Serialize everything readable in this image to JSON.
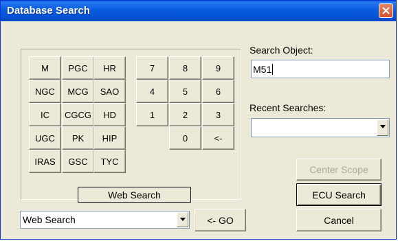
{
  "window": {
    "title": "Database Search",
    "close_icon": "close-icon"
  },
  "keypad": {
    "catalog_buttons": [
      [
        "M",
        "PGC",
        "HR"
      ],
      [
        "NGC",
        "MCG",
        "SAO"
      ],
      [
        "IC",
        "CGCG",
        "HD"
      ],
      [
        "UGC",
        "PK",
        "HIP"
      ],
      [
        "IRAS",
        "GSC",
        "TYC"
      ]
    ],
    "number_buttons": [
      [
        "7",
        "8",
        "9"
      ],
      [
        "4",
        "5",
        "6"
      ],
      [
        "1",
        "2",
        "3"
      ],
      [
        "",
        "0",
        "<-"
      ]
    ]
  },
  "search_object": {
    "label": "Search Object:",
    "value": "M51"
  },
  "recent_searches": {
    "label": "Recent Searches:",
    "value": ""
  },
  "web": {
    "status_label": "Web Search",
    "dropdown_value": "Web Search",
    "go_label": "<- GO"
  },
  "buttons": {
    "center_scope": "Center Scope",
    "ecu_search": "ECU Search",
    "cancel": "Cancel"
  }
}
